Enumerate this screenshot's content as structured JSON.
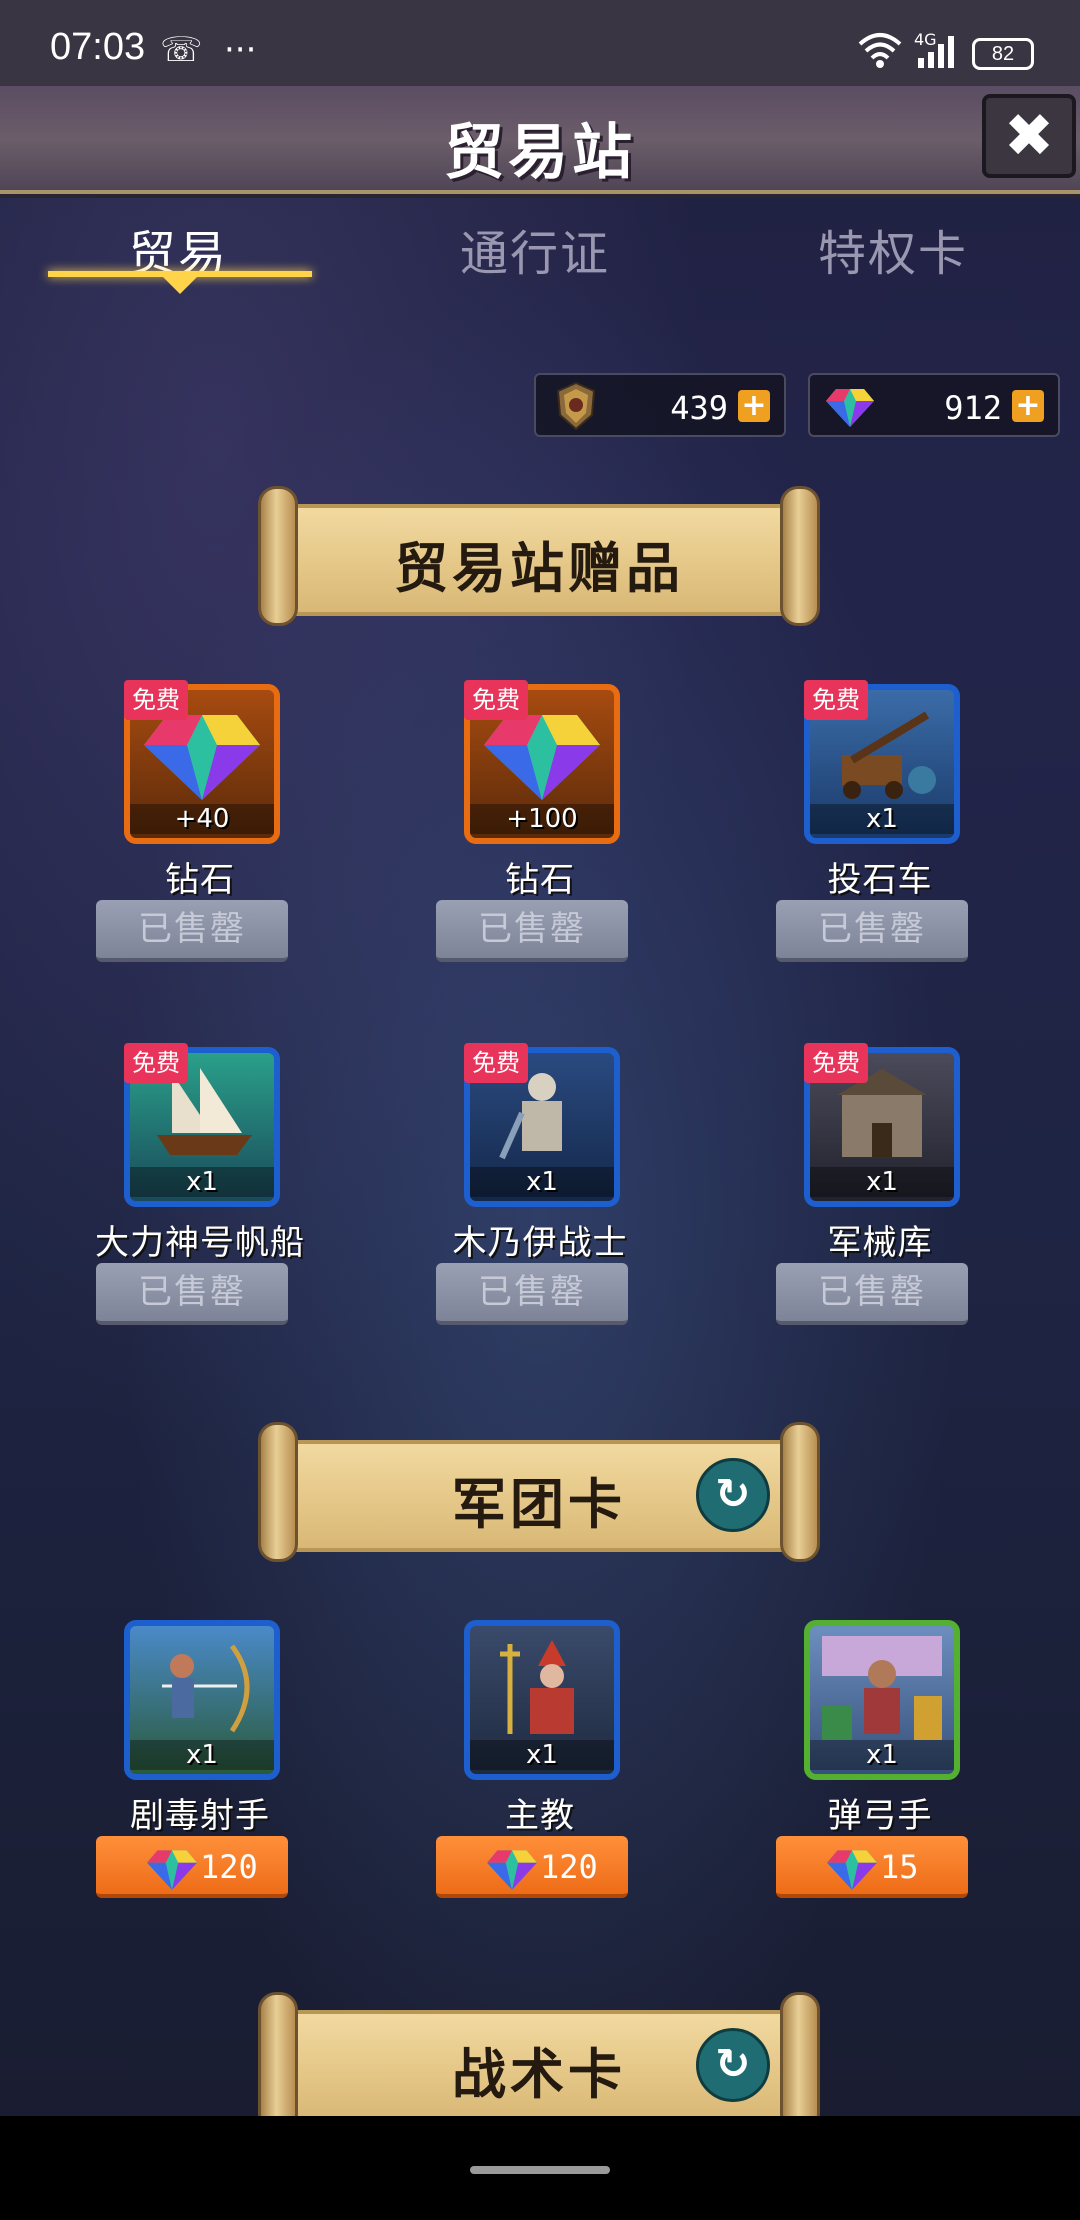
{
  "status_bar": {
    "time": "07:03",
    "call_icon": "☏",
    "more": "···",
    "wifi": "wifi",
    "signal": "4G",
    "battery": "82"
  },
  "header": {
    "title": "贸易站",
    "close": "✖"
  },
  "tabs": [
    {
      "label": "贸易",
      "active": true
    },
    {
      "label": "通行证",
      "active": false
    },
    {
      "label": "特权卡",
      "active": false
    }
  ],
  "currency": [
    {
      "icon": "crest-icon",
      "value": "439",
      "plus": "+"
    },
    {
      "icon": "diamond-icon",
      "value": "912",
      "plus": "+"
    }
  ],
  "sections": {
    "gifts": {
      "title": "贸易站赠品"
    },
    "legion": {
      "title": "军团卡",
      "refresh": "↻"
    },
    "tactics": {
      "title": "战术卡",
      "refresh": "↻"
    }
  },
  "gifts": [
    {
      "badge": "免费",
      "name": "钻石",
      "qty": "+40",
      "button": "已售罄",
      "frame": "orange",
      "art": "diamond"
    },
    {
      "badge": "免费",
      "name": "钻石",
      "qty": "+100",
      "button": "已售罄",
      "frame": "orange",
      "art": "diamond"
    },
    {
      "badge": "免费",
      "name": "投石车",
      "qty": "x1",
      "button": "已售罄",
      "frame": "blue",
      "art": "catapult"
    },
    {
      "badge": "免费",
      "name": "大力神号帆船",
      "qty": "x1",
      "button": "已售罄",
      "frame": "blue",
      "art": "ship"
    },
    {
      "badge": "免费",
      "name": "木乃伊战士",
      "qty": "x1",
      "button": "已售罄",
      "frame": "blue",
      "art": "mummy"
    },
    {
      "badge": "免费",
      "name": "军械库",
      "qty": "x1",
      "button": "已售罄",
      "frame": "blue",
      "art": "armory"
    }
  ],
  "legion_cards": [
    {
      "name": "剧毒射手",
      "qty": "x1",
      "price": "120",
      "frame": "blue",
      "art": "archer"
    },
    {
      "name": "主教",
      "qty": "x1",
      "price": "120",
      "frame": "blue",
      "art": "bishop"
    },
    {
      "name": "弹弓手",
      "qty": "x1",
      "price": "15",
      "frame": "green",
      "art": "slinger"
    }
  ]
}
